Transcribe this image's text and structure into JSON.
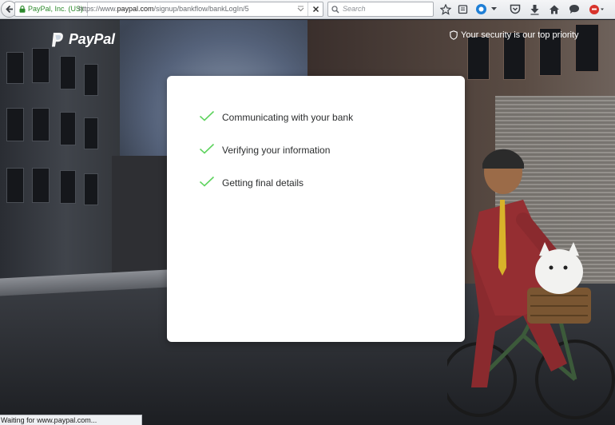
{
  "browser": {
    "identity_label": "PayPal, Inc. (US)",
    "url_prefix": "https://www.",
    "url_domain": "paypal.com",
    "url_path": "/signup/bankflow/bankLogIn/5",
    "search_placeholder": "Search",
    "toolbar_icons": [
      "bookmark-star-icon",
      "reading-list-icon",
      "sync-icon",
      "pocket-icon",
      "download-icon",
      "home-icon",
      "chat-icon",
      "extension-icon"
    ]
  },
  "header": {
    "logo_text": "PayPal",
    "security_text": "Your security is our top priority"
  },
  "progress": {
    "steps": [
      {
        "label": "Communicating with your bank",
        "done": true
      },
      {
        "label": "Verifying your information",
        "done": true
      },
      {
        "label": "Getting final details",
        "done": true
      }
    ],
    "check_color": "#5fd35f"
  },
  "statusbar": {
    "text": "Waiting for www.paypal.com..."
  },
  "colors": {
    "card_bg": "#ffffff",
    "step_text": "#2c2e2f",
    "identity_green": "#2d8a2d"
  }
}
